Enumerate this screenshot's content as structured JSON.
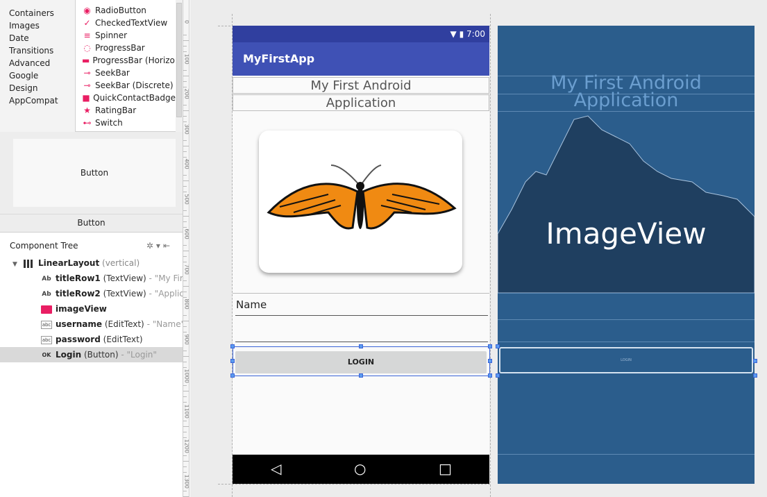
{
  "palette": {
    "categories": [
      "Containers",
      "Images",
      "Date",
      "Transitions",
      "Advanced",
      "Google",
      "Design",
      "AppCompat"
    ],
    "widgets": [
      {
        "label": "RadioButton",
        "icon": "radio-button-icon",
        "glyph": "◉"
      },
      {
        "label": "CheckedTextView",
        "icon": "checked-text-icon",
        "glyph": "✓"
      },
      {
        "label": "Spinner",
        "icon": "spinner-icon",
        "glyph": "≡"
      },
      {
        "label": "ProgressBar",
        "icon": "progress-circle-icon",
        "glyph": "◌"
      },
      {
        "label": "ProgressBar (Horizont",
        "icon": "progress-bar-icon",
        "glyph": "▬"
      },
      {
        "label": "SeekBar",
        "icon": "seekbar-icon",
        "glyph": "⊸"
      },
      {
        "label": "SeekBar (Discrete)",
        "icon": "seekbar-discrete-icon",
        "glyph": "⊸"
      },
      {
        "label": "QuickContactBadge",
        "icon": "contact-badge-icon",
        "glyph": "■"
      },
      {
        "label": "RatingBar",
        "icon": "star-icon",
        "glyph": "★"
      },
      {
        "label": "Switch",
        "icon": "switch-icon",
        "glyph": "⊷"
      }
    ]
  },
  "preview": {
    "box_label": "Button",
    "caption": "Button"
  },
  "component_tree": {
    "title": "Component Tree",
    "items": [
      {
        "name": "LinearLayout",
        "type": "(vertical)",
        "hint": ""
      },
      {
        "name": "titleRow1",
        "type": "(TextView)",
        "hint": "- \"My First Ar"
      },
      {
        "name": "titleRow2",
        "type": "(TextView)",
        "hint": "- \"Applicatio"
      },
      {
        "name": "imageView",
        "type": "",
        "hint": ""
      },
      {
        "name": "username",
        "type": "(EditText)",
        "hint": "- \"Name\""
      },
      {
        "name": "password",
        "type": "(EditText)",
        "hint": ""
      },
      {
        "name": "Login",
        "type": "(Button)",
        "hint": "- \"Login\""
      }
    ]
  },
  "ruler": {
    "labels": [
      "0",
      "100",
      "200",
      "300",
      "400",
      "500",
      "600",
      "700",
      "800",
      "900",
      "1000",
      "1100",
      "1200",
      "1300"
    ]
  },
  "design": {
    "status_time": "7:00",
    "app_title": "MyFirstApp",
    "title_row1": "My First Android",
    "title_row2": "Application",
    "username_text": "Name",
    "login_label": "LOGIN"
  },
  "blueprint": {
    "title_row1": "My First Android",
    "title_row2": "Application",
    "image_label": "ImageView",
    "login_label": "LOGIN"
  },
  "colors": {
    "primary": "#3f51b5",
    "primary_dark": "#303f9f",
    "blueprint": "#2b5d8c",
    "accent": "#e91e63"
  }
}
